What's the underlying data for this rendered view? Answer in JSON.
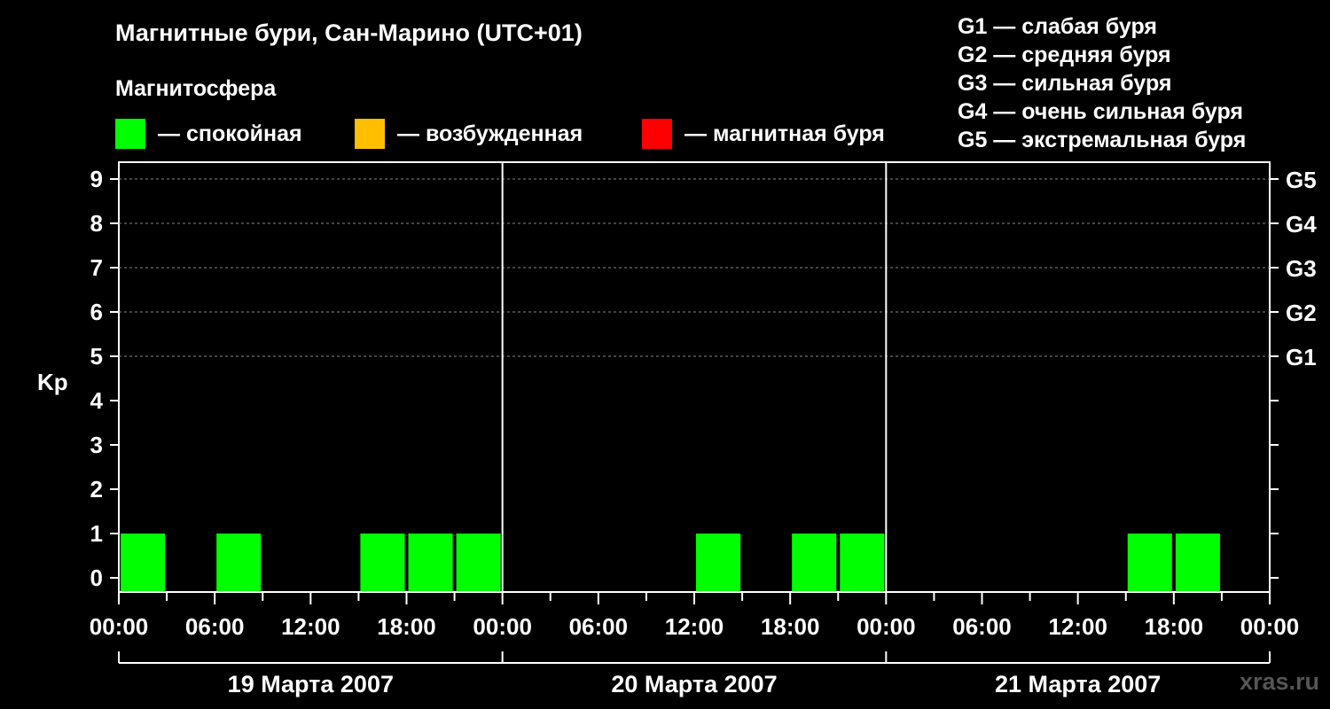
{
  "header": {
    "title": "Магнитные бури, Сан-Марино (UTC+01)",
    "subtitle": "Магнитосфера"
  },
  "legend": [
    {
      "color": "#00ff00",
      "label": "— спокойная"
    },
    {
      "color": "#ffbf00",
      "label": "— возбужденная"
    },
    {
      "color": "#ff0000",
      "label": "— магнитная буря"
    }
  ],
  "g_legend": [
    "G1 — слабая буря",
    "G2 — средняя буря",
    "G3 — сильная буря",
    "G4 — очень сильная буря",
    "G5 — экстремальная буря"
  ],
  "watermark": "xras.ru",
  "chart_data": {
    "type": "bar",
    "ylabel": "Kp",
    "ylim": [
      0,
      9
    ],
    "y_ticks": [
      "0",
      "1",
      "2",
      "3",
      "4",
      "5",
      "6",
      "7",
      "8",
      "9"
    ],
    "g_scale": [
      {
        "kp": 5,
        "label": "G1"
      },
      {
        "kp": 6,
        "label": "G2"
      },
      {
        "kp": 7,
        "label": "G3"
      },
      {
        "kp": 8,
        "label": "G4"
      },
      {
        "kp": 9,
        "label": "G5"
      }
    ],
    "x_tick_labels": [
      "00:00",
      "06:00",
      "12:00",
      "18:00",
      "00:00",
      "06:00",
      "12:00",
      "18:00",
      "00:00",
      "06:00",
      "12:00",
      "18:00",
      "00:00"
    ],
    "days": [
      "19 Марта 2007",
      "20 Марта 2007",
      "21 Марта 2007"
    ],
    "interval_hours": 3,
    "grid": "dashed horizontal at Kp 5-9",
    "series": [
      {
        "values": [
          1,
          0,
          1,
          0,
          0,
          1,
          1,
          1,
          0,
          0,
          0,
          0,
          1,
          0,
          1,
          1,
          0,
          0,
          0,
          0,
          0,
          1,
          1,
          0
        ],
        "colors": [
          "#00ff00",
          "#00ff00",
          "#00ff00",
          "#00ff00",
          "#00ff00",
          "#00ff00",
          "#00ff00",
          "#00ff00",
          "#00ff00",
          "#00ff00",
          "#00ff00",
          "#00ff00",
          "#00ff00",
          "#00ff00",
          "#00ff00",
          "#00ff00",
          "#00ff00",
          "#00ff00",
          "#00ff00",
          "#00ff00",
          "#00ff00",
          "#00ff00",
          "#00ff00",
          "#00ff00"
        ]
      }
    ]
  }
}
